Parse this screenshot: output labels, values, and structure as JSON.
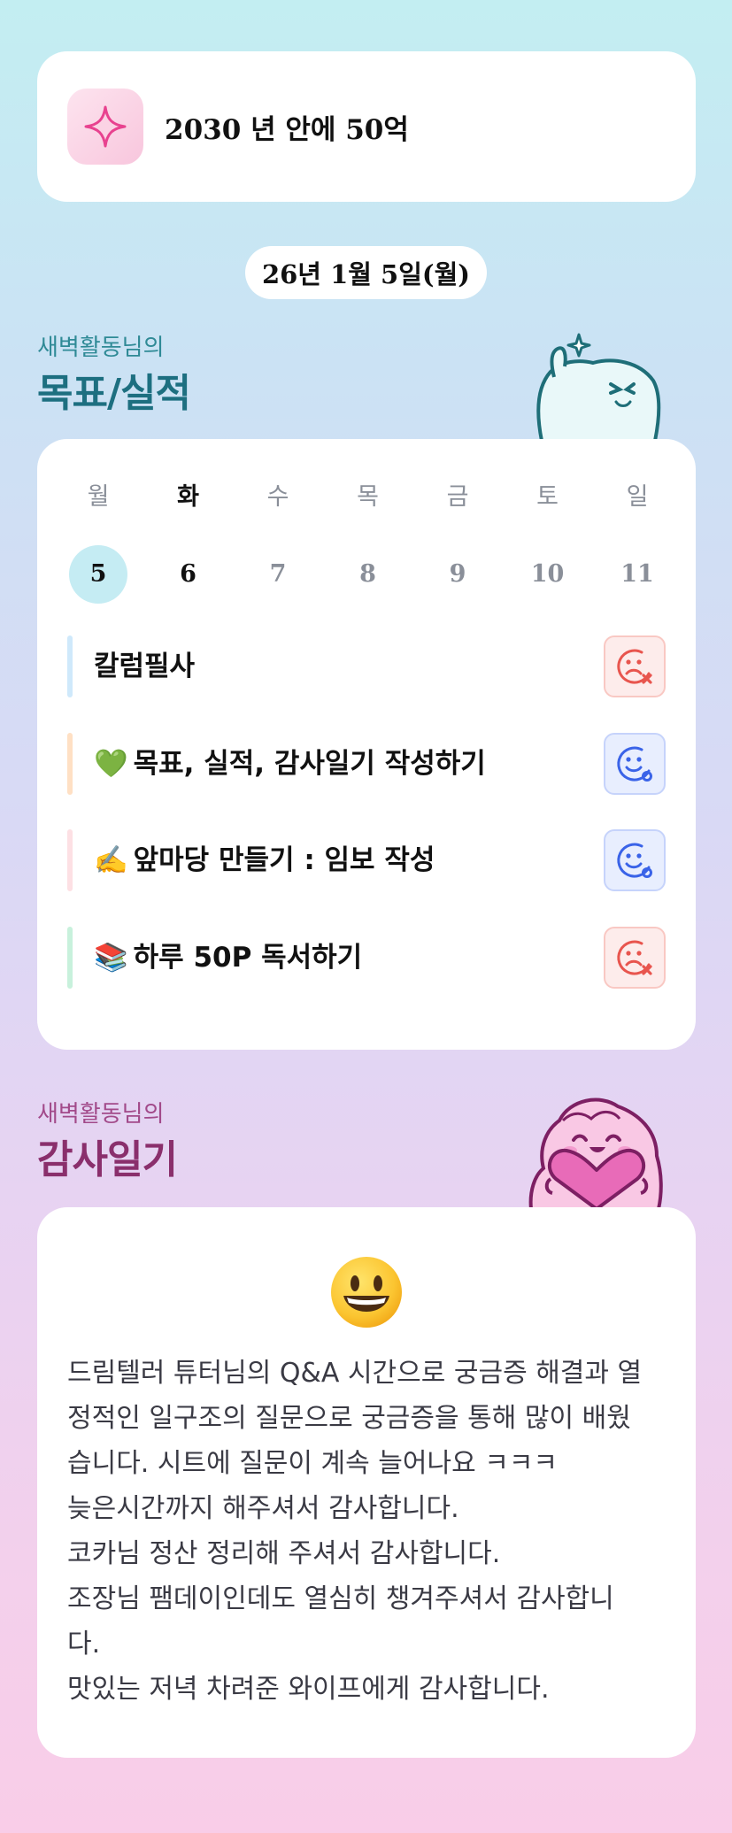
{
  "goal": {
    "icon": "sparkle-icon",
    "text": "2030 년 안에 50억"
  },
  "date": "26년 1월 5일(월)",
  "goals_section": {
    "subtitle": "새벽활동님의",
    "title": "목표/실적"
  },
  "week": {
    "days": [
      {
        "weekday": "월",
        "date": "5"
      },
      {
        "weekday": "화",
        "date": "6"
      },
      {
        "weekday": "수",
        "date": "7"
      },
      {
        "weekday": "목",
        "date": "8"
      },
      {
        "weekday": "금",
        "date": "9"
      },
      {
        "weekday": "토",
        "date": "10"
      },
      {
        "weekday": "일",
        "date": "11"
      }
    ],
    "selected_index": 0
  },
  "tasks": [
    {
      "emoji": "",
      "label": "칼럼필사",
      "status": "fail",
      "status_icon": "sad-face-x-icon",
      "bar_color": "#cfe9fb"
    },
    {
      "emoji": "💚",
      "label": "목표, 실적, 감사일기 작성하기",
      "status": "done",
      "status_icon": "smile-face-check-icon",
      "bar_color": "#ffe0c4"
    },
    {
      "emoji": "✍️",
      "label": "앞마당 만들기 : 임보 작성",
      "status": "done",
      "status_icon": "smile-face-check-icon",
      "bar_color": "#fde0e4"
    },
    {
      "emoji": "📚",
      "label": "하루 50P 독서하기",
      "status": "fail",
      "status_icon": "sad-face-x-icon",
      "bar_color": "#c8f1dc"
    }
  ],
  "gratitude_section": {
    "subtitle": "새벽활동님의",
    "title": "감사일기"
  },
  "gratitude": {
    "emoji": "😀",
    "lines": [
      "드림텔러 튜터님의 Q&A 시간으로 궁금증 해결과 열",
      "정적인 일구조의 질문으로 궁금증을 통해 많이 배웠",
      "습니다. 시트에 질문이 계속 늘어나요 ㅋㅋㅋ",
      "늦은시간까지 해주셔서 감사합니다.",
      "코카님 정산 정리해 주셔서 감사합니다.",
      "조장님 팸데이인데도 열심히 챙겨주셔서 감사합니",
      "다.",
      "맛있는 저녁 차려준 와이프에게 감사합니다."
    ]
  },
  "colors": {
    "fail_red": "#e8554e",
    "done_blue": "#3a63e8",
    "goals_title": "#1d6f80",
    "gratitude_title": "#8a2f6c"
  }
}
